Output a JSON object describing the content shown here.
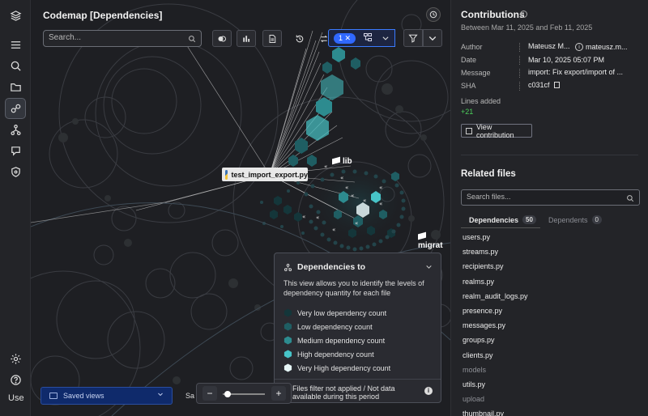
{
  "rail": {
    "items": [
      "logo",
      "menu",
      "search",
      "folder",
      "codemap",
      "branches",
      "tags",
      "shield"
    ],
    "bottom": [
      "settings",
      "help"
    ],
    "user_label": "Use"
  },
  "canvas": {
    "title": "Codemap [Dependencies]",
    "search_placeholder": "Search...",
    "selection_count": "1",
    "node_label": "test_import_export.py",
    "tag_lib": "lib",
    "tag_migrat": "migrat"
  },
  "legend": {
    "title": "Dependencies to",
    "description": "This view allows you to identify the levels of dependency quantity for each file",
    "levels": [
      {
        "label": "Very low dependency count",
        "color": "#14363a"
      },
      {
        "label": "Low dependency count",
        "color": "#1f5e63"
      },
      {
        "label": "Medium dependency count",
        "color": "#2d8b8f"
      },
      {
        "label": "High dependency count",
        "color": "#47c4c8"
      },
      {
        "label": "Very High dependency count",
        "color": "#e6f6f7"
      }
    ],
    "footer": "Files filter not applied / Not data available during this period"
  },
  "bottom": {
    "saved_views": "Saved views",
    "sa_label": "Sa"
  },
  "panel": {
    "title": "Contributions",
    "range": "Between Mar 11, 2025 and Feb 11, 2025",
    "author_label": "Author",
    "author_value": "Mateusz M...",
    "author_handle": "mateusz.m...",
    "date_label": "Date",
    "date_value": "Mar 10, 2025 05:07 PM",
    "message_label": "Message",
    "message_value": "import: Fix export/import of ...",
    "sha_label": "SHA",
    "sha_value": "c031cf",
    "lines_label": "Lines added",
    "lines_value": "+21",
    "view_button": "View contribution",
    "related_title": "Related files",
    "files_placeholder": "Search files...",
    "tab_dependencies": "Dependencies",
    "tab_dependencies_count": "50",
    "tab_dependents": "Dependents",
    "tab_dependents_count": "0",
    "files": [
      {
        "name": "users.py",
        "folder": false
      },
      {
        "name": "streams.py",
        "folder": false
      },
      {
        "name": "recipients.py",
        "folder": false
      },
      {
        "name": "realms.py",
        "folder": false
      },
      {
        "name": "realm_audit_logs.py",
        "folder": false
      },
      {
        "name": "presence.py",
        "folder": false
      },
      {
        "name": "messages.py",
        "folder": false
      },
      {
        "name": "groups.py",
        "folder": false
      },
      {
        "name": "clients.py",
        "folder": false
      },
      {
        "name": "models",
        "folder": true
      },
      {
        "name": "utils.py",
        "folder": false
      },
      {
        "name": "upload",
        "folder": true
      },
      {
        "name": "thumbnail.py",
        "folder": false
      }
    ]
  }
}
